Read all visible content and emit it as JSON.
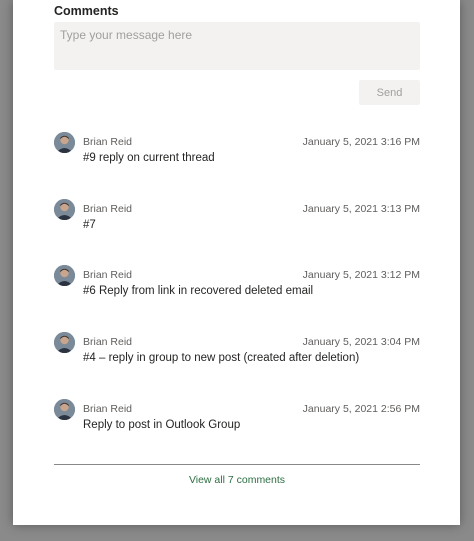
{
  "comments_panel": {
    "title": "Comments",
    "input_placeholder": "Type your message here",
    "send_label": "Send",
    "items": [
      {
        "author": "Brian Reid",
        "timestamp": "January 5, 2021 3:16 PM",
        "text": "#9 reply on current thread"
      },
      {
        "author": "Brian Reid",
        "timestamp": "January 5, 2021 3:13 PM",
        "text": "#7"
      },
      {
        "author": "Brian Reid",
        "timestamp": "January 5, 2021 3:12 PM",
        "text": "#6 Reply from link in recovered deleted email"
      },
      {
        "author": "Brian Reid",
        "timestamp": "January 5, 2021 3:04 PM",
        "text": "#4 – reply in group to new post (created after deletion)"
      },
      {
        "author": "Brian Reid",
        "timestamp": "January 5, 2021 2:56 PM",
        "text": "Reply to post in Outlook Group"
      }
    ],
    "view_all_label": "View all 7 comments"
  },
  "colors": {
    "link_accent": "#2d6e43",
    "input_background": "#f3f2f1"
  }
}
